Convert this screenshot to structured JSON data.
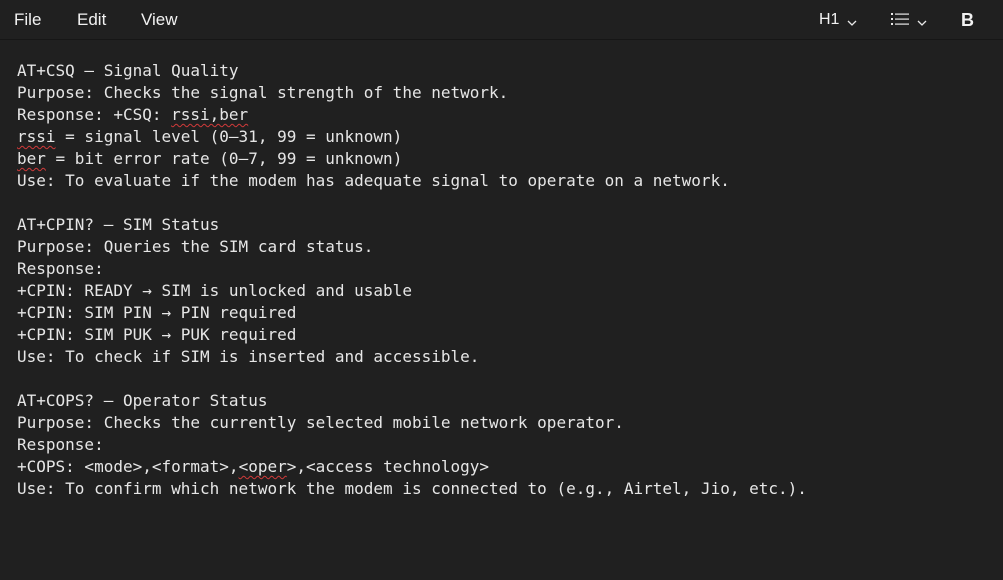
{
  "menu": {
    "file": "File",
    "edit": "Edit",
    "view": "View"
  },
  "toolbar": {
    "heading_label": "H1",
    "bold_label": "B"
  },
  "doc": {
    "csq": {
      "title": "AT+CSQ – Signal Quality",
      "purpose": "Purpose: Checks the signal strength of the network.",
      "response_prefix": "Response: +CSQ: ",
      "response_value": "rssi,ber",
      "rssi_word": "rssi",
      "rssi_rest": " = signal level (0–31, 99 = unknown)",
      "ber_word": "ber",
      "ber_rest": " = bit error rate (0–7, 99 = unknown)",
      "use": "Use: To evaluate if the modem has adequate signal to operate on a network."
    },
    "cpin": {
      "title": "AT+CPIN? – SIM Status",
      "purpose": "Purpose: Queries the SIM card status.",
      "response": "Response:",
      "ready": "+CPIN: READY → SIM is unlocked and usable",
      "simpin": "+CPIN: SIM PIN → PIN required",
      "simpuk": "+CPIN: SIM PUK → PUK required",
      "use": "Use: To check if SIM is inserted and accessible."
    },
    "cops": {
      "title": "AT+COPS? – Operator Status",
      "purpose": "Purpose: Checks the currently selected mobile network operator.",
      "response": "Response:",
      "format_a": "+COPS: <mode>,<format>,",
      "format_oper": "<oper",
      "format_b": ">,<access technology>",
      "use": "Use: To confirm which network the modem is connected to (e.g., Airtel, Jio, etc.)."
    }
  }
}
